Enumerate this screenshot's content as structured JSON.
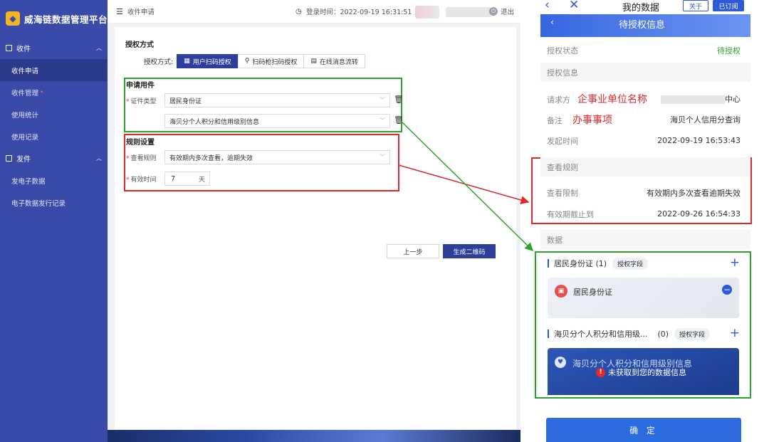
{
  "app": {
    "title": "威海链数据管理平台"
  },
  "sidebar": {
    "groups": [
      {
        "label": "收件",
        "items": [
          {
            "label": "收件申请",
            "active": true
          },
          {
            "label": "收件管理",
            "badge": "•"
          },
          {
            "label": "使用统计"
          },
          {
            "label": "使用记录"
          }
        ]
      },
      {
        "label": "发件",
        "items": [
          {
            "label": "发电子数据"
          },
          {
            "label": "电子数据发行记录"
          }
        ]
      }
    ]
  },
  "header": {
    "page_label": "收件申请",
    "login_time": "登录时间：2022-09-19 16:31:51",
    "logout_label": "退出"
  },
  "form": {
    "auth_section": "授权方式",
    "auth_label": "授权方式:",
    "auth_options": [
      "用户扫码授权",
      "扫码枪扫码授权",
      "在线消息流转"
    ],
    "docs_section": "申请用件",
    "doc_type_label": "证件类型",
    "doc_type_1": "居民身份证",
    "doc_type_2": "海贝分个人积分和信用级别信息",
    "rules_section": "规则设置",
    "view_rule_label": "查看规则",
    "view_rule_value": "有效期内多次查看，逾期失效",
    "valid_label": "有效时间",
    "valid_value": "7",
    "valid_unit": "天",
    "btn_prev": "上一步",
    "btn_generate": "生成二维码"
  },
  "mobile": {
    "title": "我的数据",
    "about": "关于",
    "subscribed": "已订阅",
    "bar_title": "待授权信息",
    "status_label": "授权状态",
    "status_value": "待授权",
    "info_section": "授权信息",
    "requester_label": "请求方",
    "requester_annot": "企事业单位名称",
    "requester_suffix": "中心",
    "remark_label": "备注",
    "remark_annot": "办事事项",
    "remark_value": "海贝个人信用分查询",
    "start_label": "发起时间",
    "start_value": "2022-09-19 16:53:43",
    "rules_section": "查看规则",
    "limit_label": "查看限制",
    "limit_value": "有效期内多次查看逾期失效",
    "expire_label": "有效期截止到",
    "expire_value": "2022-09-26 16:54:33",
    "data_section": "数据",
    "item1_title": "居民身份证 (1)",
    "item_tag": "授权字段",
    "item1_card": "居民身份证",
    "item2_title": "海贝分个人积分和信用级...",
    "item2_count": "(0)",
    "item2_card": "海贝分个人积分和信用级别信息",
    "item2_warn": "未获取到您的数据信息",
    "confirm": "确 定"
  },
  "colors": {
    "primary": "#2d3e9b",
    "sidebar": "#3a4aa8",
    "mobile_accent": "#2c59d6",
    "annot_red": "#e02a2a",
    "annot_green": "#2aa62a"
  }
}
